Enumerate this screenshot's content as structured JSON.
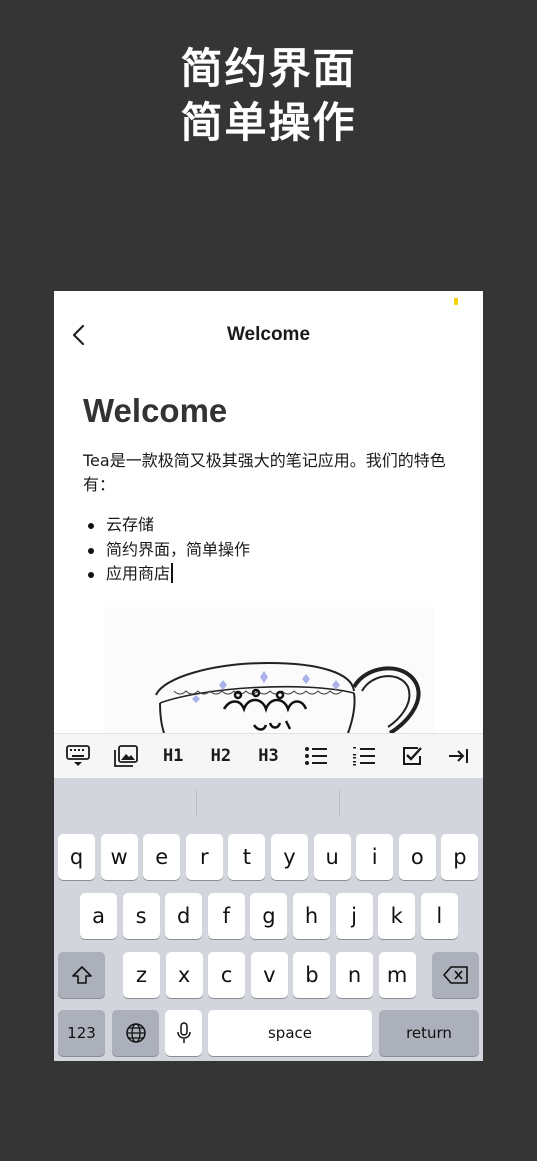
{
  "promo": {
    "line1": "简约界面",
    "line2": "简单操作"
  },
  "status_indicator_color": "#f5d300",
  "nav": {
    "title": "Welcome",
    "back_icon": "chevron-left-icon"
  },
  "document": {
    "heading": "Welcome",
    "paragraph": "Tea是一款极简又极其强大的笔记应用。我们的特色有：",
    "list_items": [
      "云存储",
      "简约界面，简单操作",
      "应用商店"
    ]
  },
  "format_bar": {
    "items": [
      {
        "name": "keyboard-dismiss-icon",
        "label": ""
      },
      {
        "name": "image-icon",
        "label": ""
      },
      {
        "name": "heading-1",
        "label": "H1"
      },
      {
        "name": "heading-2",
        "label": "H2"
      },
      {
        "name": "heading-3",
        "label": "H3"
      },
      {
        "name": "bullet-list-icon",
        "label": ""
      },
      {
        "name": "numbered-list-icon",
        "label": ""
      },
      {
        "name": "checkbox-icon",
        "label": ""
      },
      {
        "name": "indent-icon",
        "label": ""
      }
    ]
  },
  "keyboard": {
    "row1": [
      "q",
      "w",
      "e",
      "r",
      "t",
      "y",
      "u",
      "i",
      "o",
      "p"
    ],
    "row2": [
      "a",
      "s",
      "d",
      "f",
      "g",
      "h",
      "j",
      "k",
      "l"
    ],
    "row3": [
      "z",
      "x",
      "c",
      "v",
      "b",
      "n",
      "m"
    ],
    "numbers_label": "123",
    "space_label": "space",
    "return_label": "return",
    "shift_icon": "shift-icon",
    "delete_icon": "delete-icon",
    "globe_icon": "globe-icon",
    "mic_icon": "microphone-icon"
  }
}
